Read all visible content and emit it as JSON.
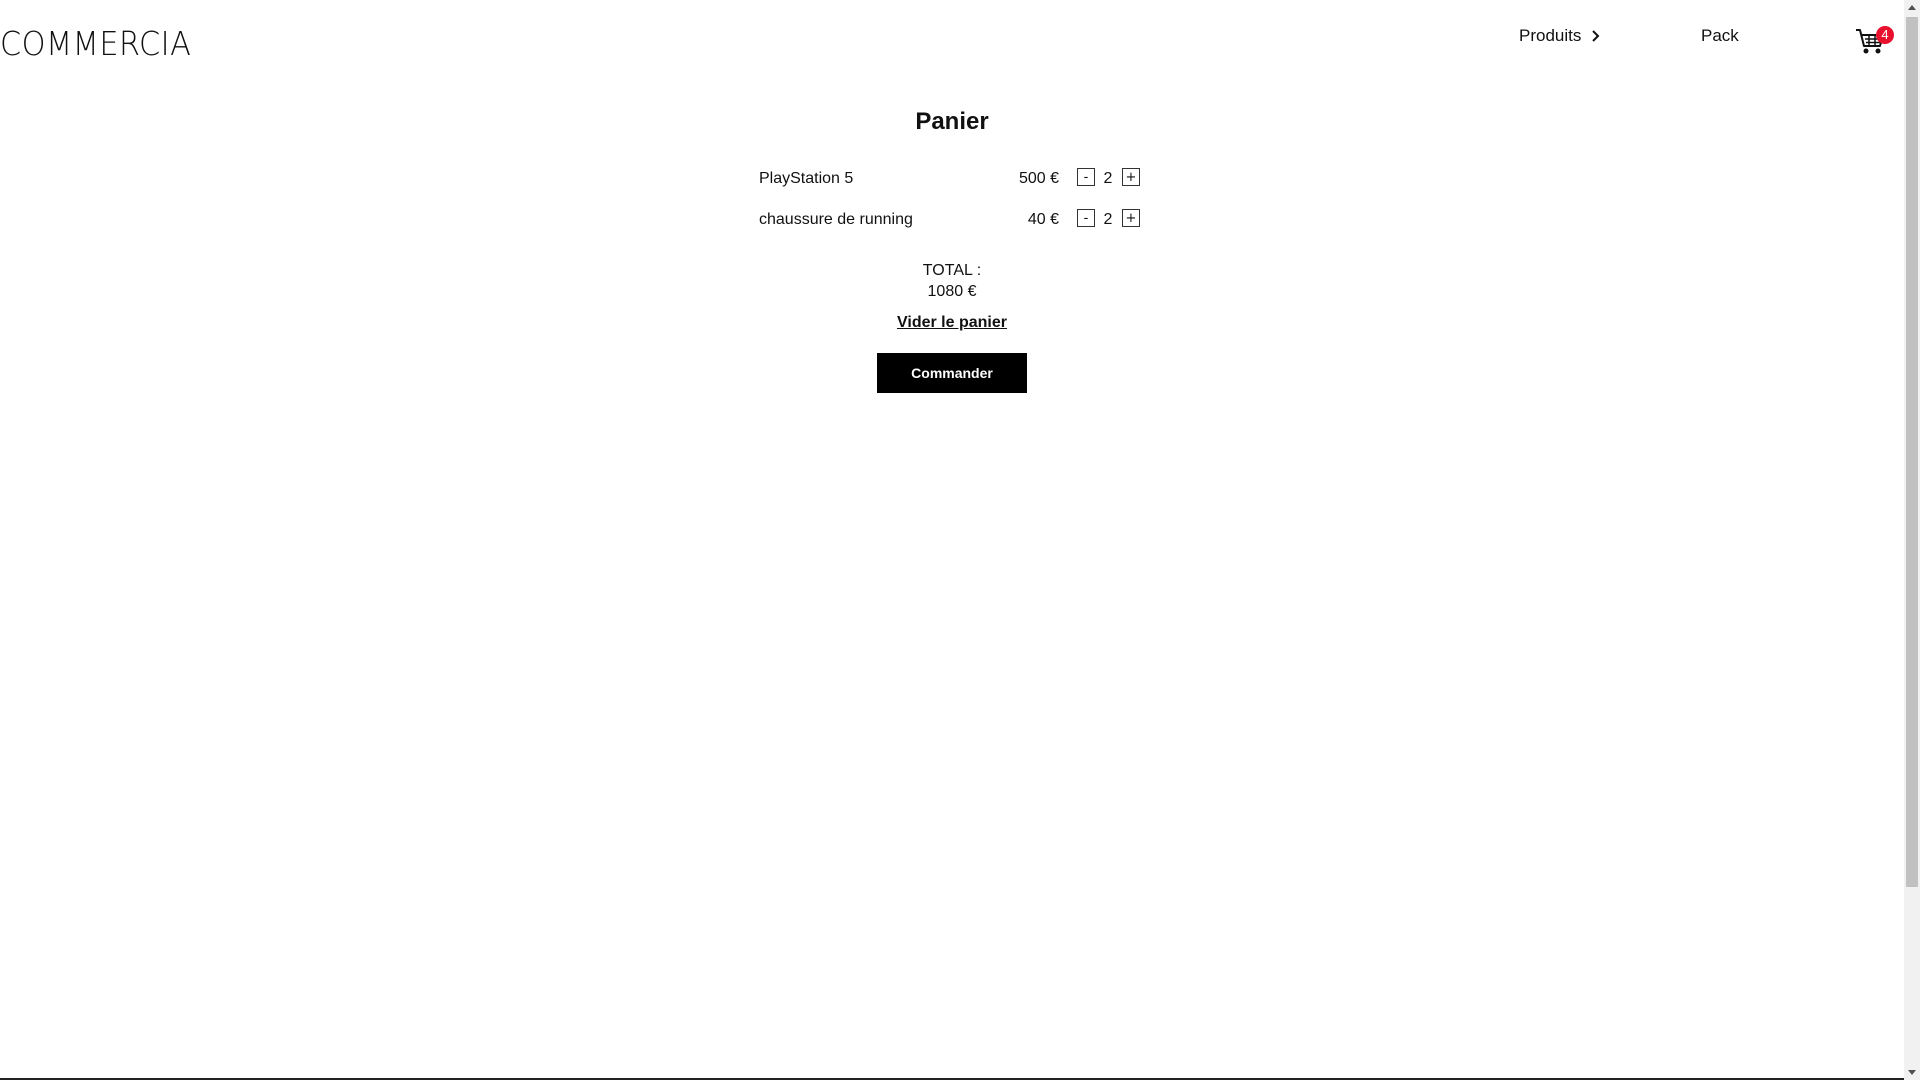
{
  "header": {
    "logo": "COMMERCIA",
    "nav_produits": "Produits",
    "nav_pack": "Pack",
    "cart_count": "4"
  },
  "cart": {
    "title": "Panier",
    "items": [
      {
        "name": "PlayStation 5",
        "price": "500 €",
        "qty": "2",
        "minus": "-",
        "plus": "+"
      },
      {
        "name": "chaussure de running",
        "price": "40 €",
        "qty": "2",
        "minus": "-",
        "plus": "+"
      }
    ],
    "total_label": "TOTAL :",
    "total_value": "1080 €",
    "empty_label": "Vider le panier",
    "order_label": "Commander"
  },
  "colors": {
    "badge": "#e8112d",
    "button_bg": "#000000"
  }
}
